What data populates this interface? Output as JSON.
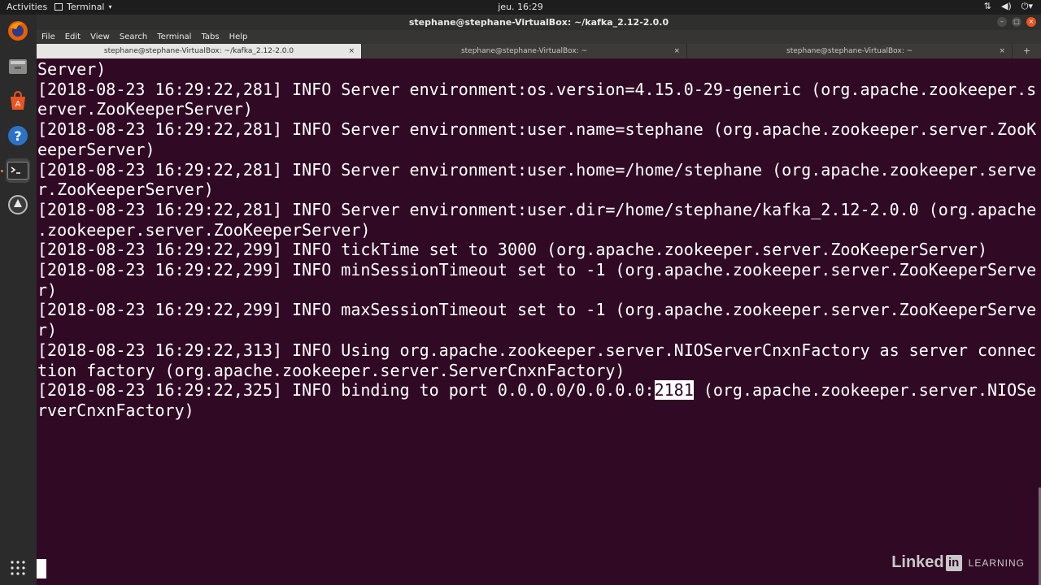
{
  "topbar": {
    "activities": "Activities",
    "app_menu": "Terminal",
    "clock": "jeu. 16:29",
    "tray": [
      "network-icon",
      "volume-icon",
      "power-icon"
    ]
  },
  "dock": {
    "apps": [
      "firefox-icon",
      "files-icon",
      "software-center-icon",
      "help-icon",
      "terminal-icon",
      "software-updater-icon"
    ],
    "show_apps_icon": "apps-grid-icon"
  },
  "window": {
    "title": "stephane@stephane-VirtualBox: ~/kafka_2.12-2.0.0"
  },
  "menubar": [
    "File",
    "Edit",
    "View",
    "Search",
    "Terminal",
    "Tabs",
    "Help"
  ],
  "tabs": [
    {
      "label": "stephane@stephane-VirtualBox: ~/kafka_2.12-2.0.0",
      "active": true
    },
    {
      "label": "stephane@stephane-VirtualBox: ~",
      "active": false
    },
    {
      "label": "stephane@stephane-VirtualBox: ~",
      "active": false
    }
  ],
  "terminal": {
    "lines": [
      "Server)",
      "[2018-08-23 16:29:22,281] INFO Server environment:os.version=4.15.0-29-generic (org.apache.zookeeper.s",
      "erver.ZooKeeperServer)",
      "[2018-08-23 16:29:22,281] INFO Server environment:user.name=stephane (org.apache.zookeeper.server.ZooK",
      "eeperServer)",
      "[2018-08-23 16:29:22,281] INFO Server environment:user.home=/home/stephane (org.apache.zookeeper.serve",
      "r.ZooKeeperServer)",
      "[2018-08-23 16:29:22,281] INFO Server environment:user.dir=/home/stephane/kafka_2.12-2.0.0 (org.apache",
      ".zookeeper.server.ZooKeeperServer)",
      "[2018-08-23 16:29:22,299] INFO tickTime set to 3000 (org.apache.zookeeper.server.ZooKeeperServer)",
      "[2018-08-23 16:29:22,299] INFO minSessionTimeout set to -1 (org.apache.zookeeper.server.ZooKeeperServe",
      "r)",
      "[2018-08-23 16:29:22,299] INFO maxSessionTimeout set to -1 (org.apache.zookeeper.server.ZooKeeperServe",
      "r)",
      "[2018-08-23 16:29:22,313] INFO Using org.apache.zookeeper.server.NIOServerCnxnFactory as server connec",
      "tion factory (org.apache.zookeeper.server.ServerCnxnFactory)"
    ],
    "last_line_before": "[2018-08-23 16:29:22,325] INFO binding to port 0.0.0.0/0.0.0.0:",
    "selected_text": "2181",
    "last_line_after": " (org.apache.zookeeper.server.NIOSe",
    "final_line": "rverCnxnFactory)"
  },
  "watermark": {
    "brand": "Linked",
    "brand_in": "in",
    "learning": "LEARNING"
  }
}
